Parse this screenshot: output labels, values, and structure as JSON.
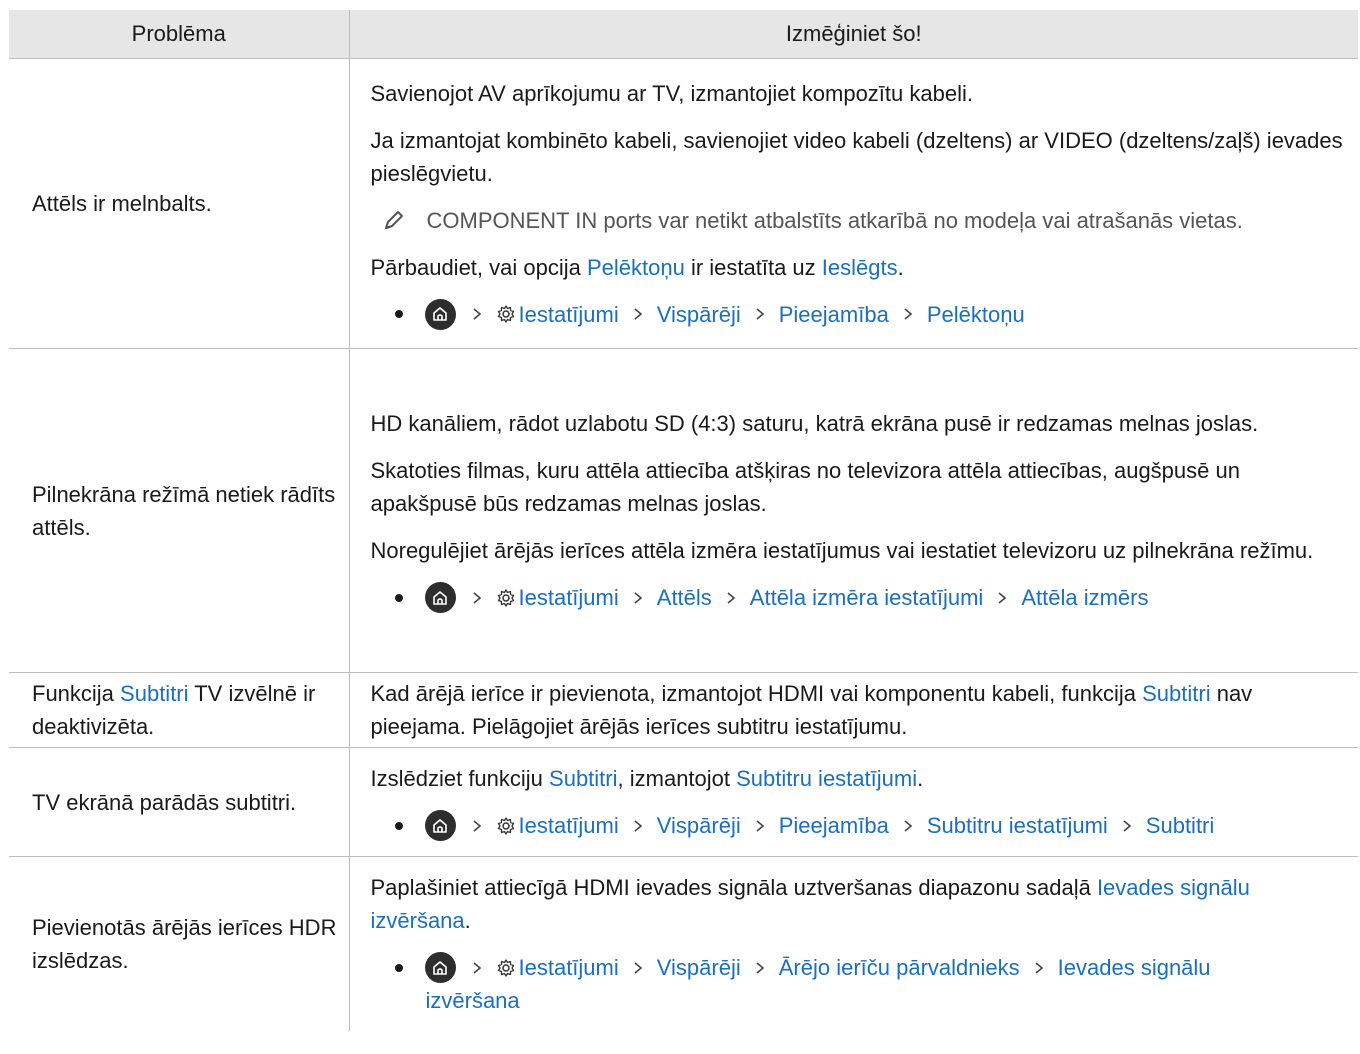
{
  "header": {
    "col1": "Problēma",
    "col2": "Izmēģiniet šo!"
  },
  "rows": [
    {
      "problem": "Attēls ir melnbalts.",
      "p1": "Savienojot AV aprīkojumu ar TV, izmantojiet kompozītu kabeli.",
      "p2": "Ja izmantojat kombinēto kabeli, savienojiet video kabeli (dzeltens) ar VIDEO (dzeltens/zaļš) ievades pieslēgvietu.",
      "note": "COMPONENT IN ports var netikt atbalstīts atkarībā no modeļa vai atrašanās vietas.",
      "p3a": "Pārbaudiet, vai opcija ",
      "p3b": "Pelēktoņu",
      "p3c": " ir iestatīta uz ",
      "p3d": "Ieslēgts",
      "p3e": ".",
      "path": [
        "Iestatījumi",
        "Vispārēji",
        "Pieejamība",
        "Pelēktoņu"
      ]
    },
    {
      "problem": "Pilnekrāna režīmā netiek rādīts attēls.",
      "p1": "HD kanāliem, rādot uzlabotu SD (4:3) saturu, katrā ekrāna pusē ir redzamas melnas joslas.",
      "p2": "Skatoties filmas, kuru attēla attiecība atšķiras no televizora attēla attiecības, augšpusē un apakšpusē būs redzamas melnas joslas.",
      "p3": "Noregulējiet ārējās ierīces attēla izmēra iestatījumus vai iestatiet televizoru uz pilnekrāna režīmu.",
      "path": [
        "Iestatījumi",
        "Attēls",
        "Attēla izmēra iestatījumi",
        "Attēla izmērs"
      ]
    },
    {
      "problem_a": "Funkcija ",
      "problem_b": "Subtitri",
      "problem_c": " TV izvēlnē ir deaktivizēta.",
      "p1a": "Kad ārējā ierīce ir pievienota, izmantojot HDMI vai komponentu kabeli, funkcija ",
      "p1b": "Subtitri",
      "p1c": " nav pieejama. Pielāgojiet ārējās ierīces subtitru iestatījumu."
    },
    {
      "problem": "TV ekrānā parādās subtitri.",
      "p1a": "Izslēdziet funkciju ",
      "p1b": "Subtitri",
      "p1c": ", izmantojot ",
      "p1d": "Subtitru iestatījumi",
      "p1e": ".",
      "path": [
        "Iestatījumi",
        "Vispārēji",
        "Pieejamība",
        "Subtitru iestatījumi",
        "Subtitri"
      ]
    },
    {
      "problem": "Pievienotās ārējās ierīces HDR izslēdzas.",
      "p1a": "Paplašiniet attiecīgā HDMI ievades signāla uztveršanas diapazonu sadaļā ",
      "p1b": "Ievades signālu izvēršana",
      "p1c": ".",
      "path": [
        "Iestatījumi",
        "Vispārēji",
        "Ārējo ierīču pārvaldnieks",
        "Ievades signālu"
      ],
      "path_wrap": "izvēršana"
    }
  ],
  "icons": {
    "home": "home-icon",
    "settings": "gear-icon",
    "chevron": "chevron-right-icon",
    "note": "pencil-icon"
  },
  "colors": {
    "link": "#1a6fc1",
    "header_bg": "#e6e6e6",
    "border": "#bdbdbd"
  }
}
